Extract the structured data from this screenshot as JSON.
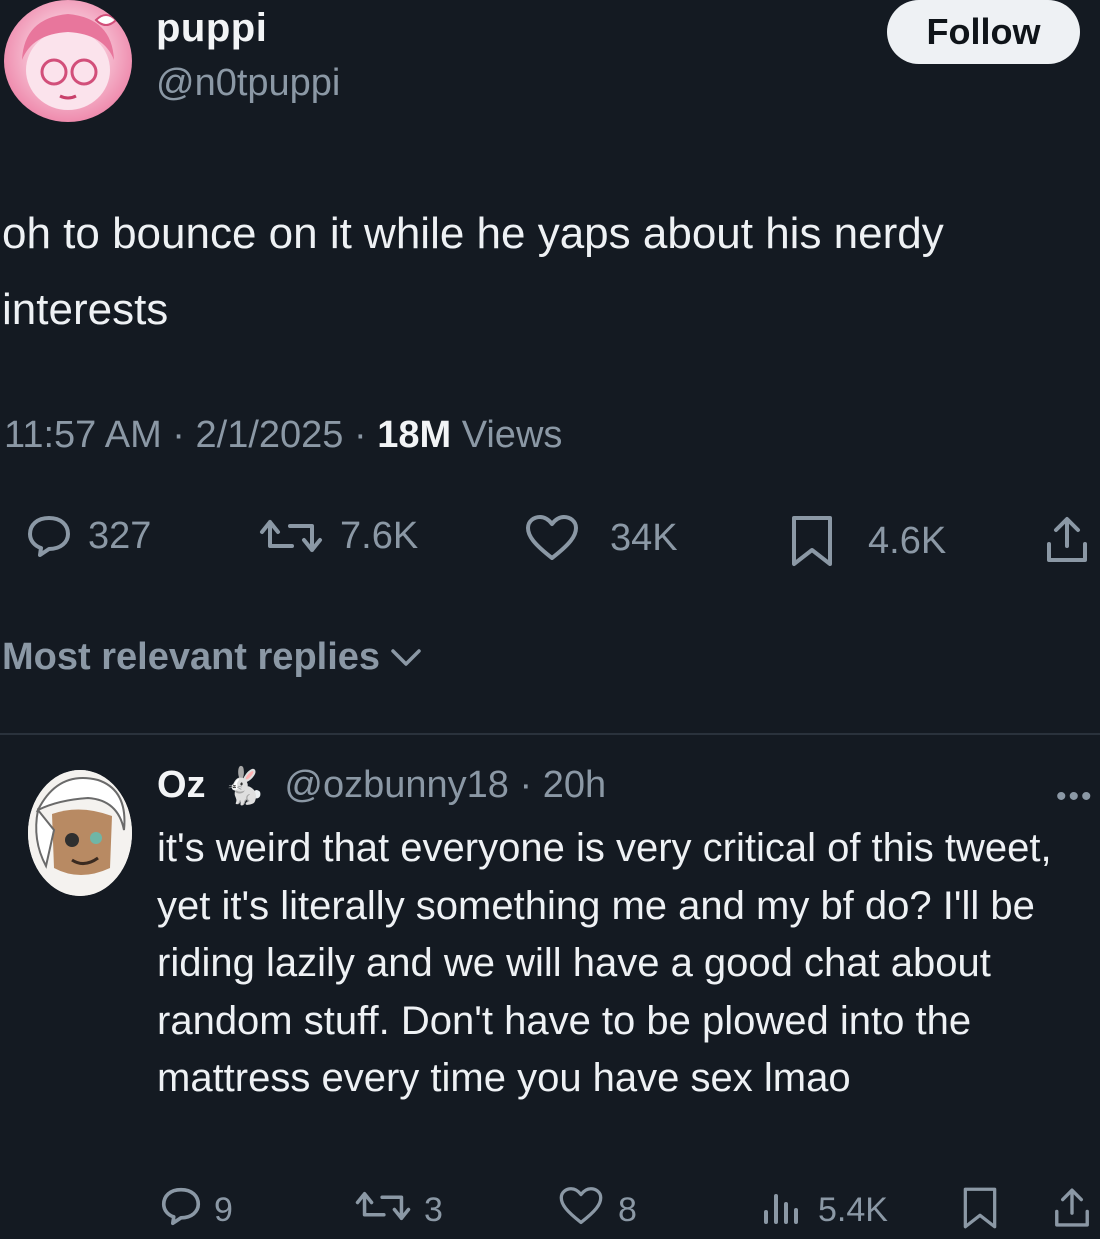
{
  "tweet": {
    "display_name": "puppi",
    "handle": "@n0tpuppi",
    "follow_label": "Follow",
    "text": "oh to bounce on it while he yaps about his nerdy interests",
    "time": "11:57 AM",
    "date": "2/1/2025",
    "views_count": "18M",
    "views_label": "Views",
    "actions": {
      "replies": "327",
      "reposts": "7.6K",
      "likes": "34K",
      "bookmarks": "4.6K"
    }
  },
  "replies_sort_label": "Most relevant replies",
  "reply": {
    "display_name": "Oz",
    "emoji": "🐇",
    "handle": "@ozbunny18",
    "time": "20h",
    "more": "•••",
    "text": "it's weird that everyone is very critical of this tweet, yet it's literally something me and my bf do? I'll be riding lazily and we will have a good chat about random stuff. Don't have to be plowed into the mattress every time you have sex lmao",
    "actions": {
      "replies": "9",
      "reposts": "3",
      "likes": "8",
      "views": "5.4K"
    }
  },
  "colors": {
    "background": "#141a22",
    "text": "#eef1f4",
    "muted": "#8b98a5",
    "follow_bg": "#eef1f4"
  }
}
